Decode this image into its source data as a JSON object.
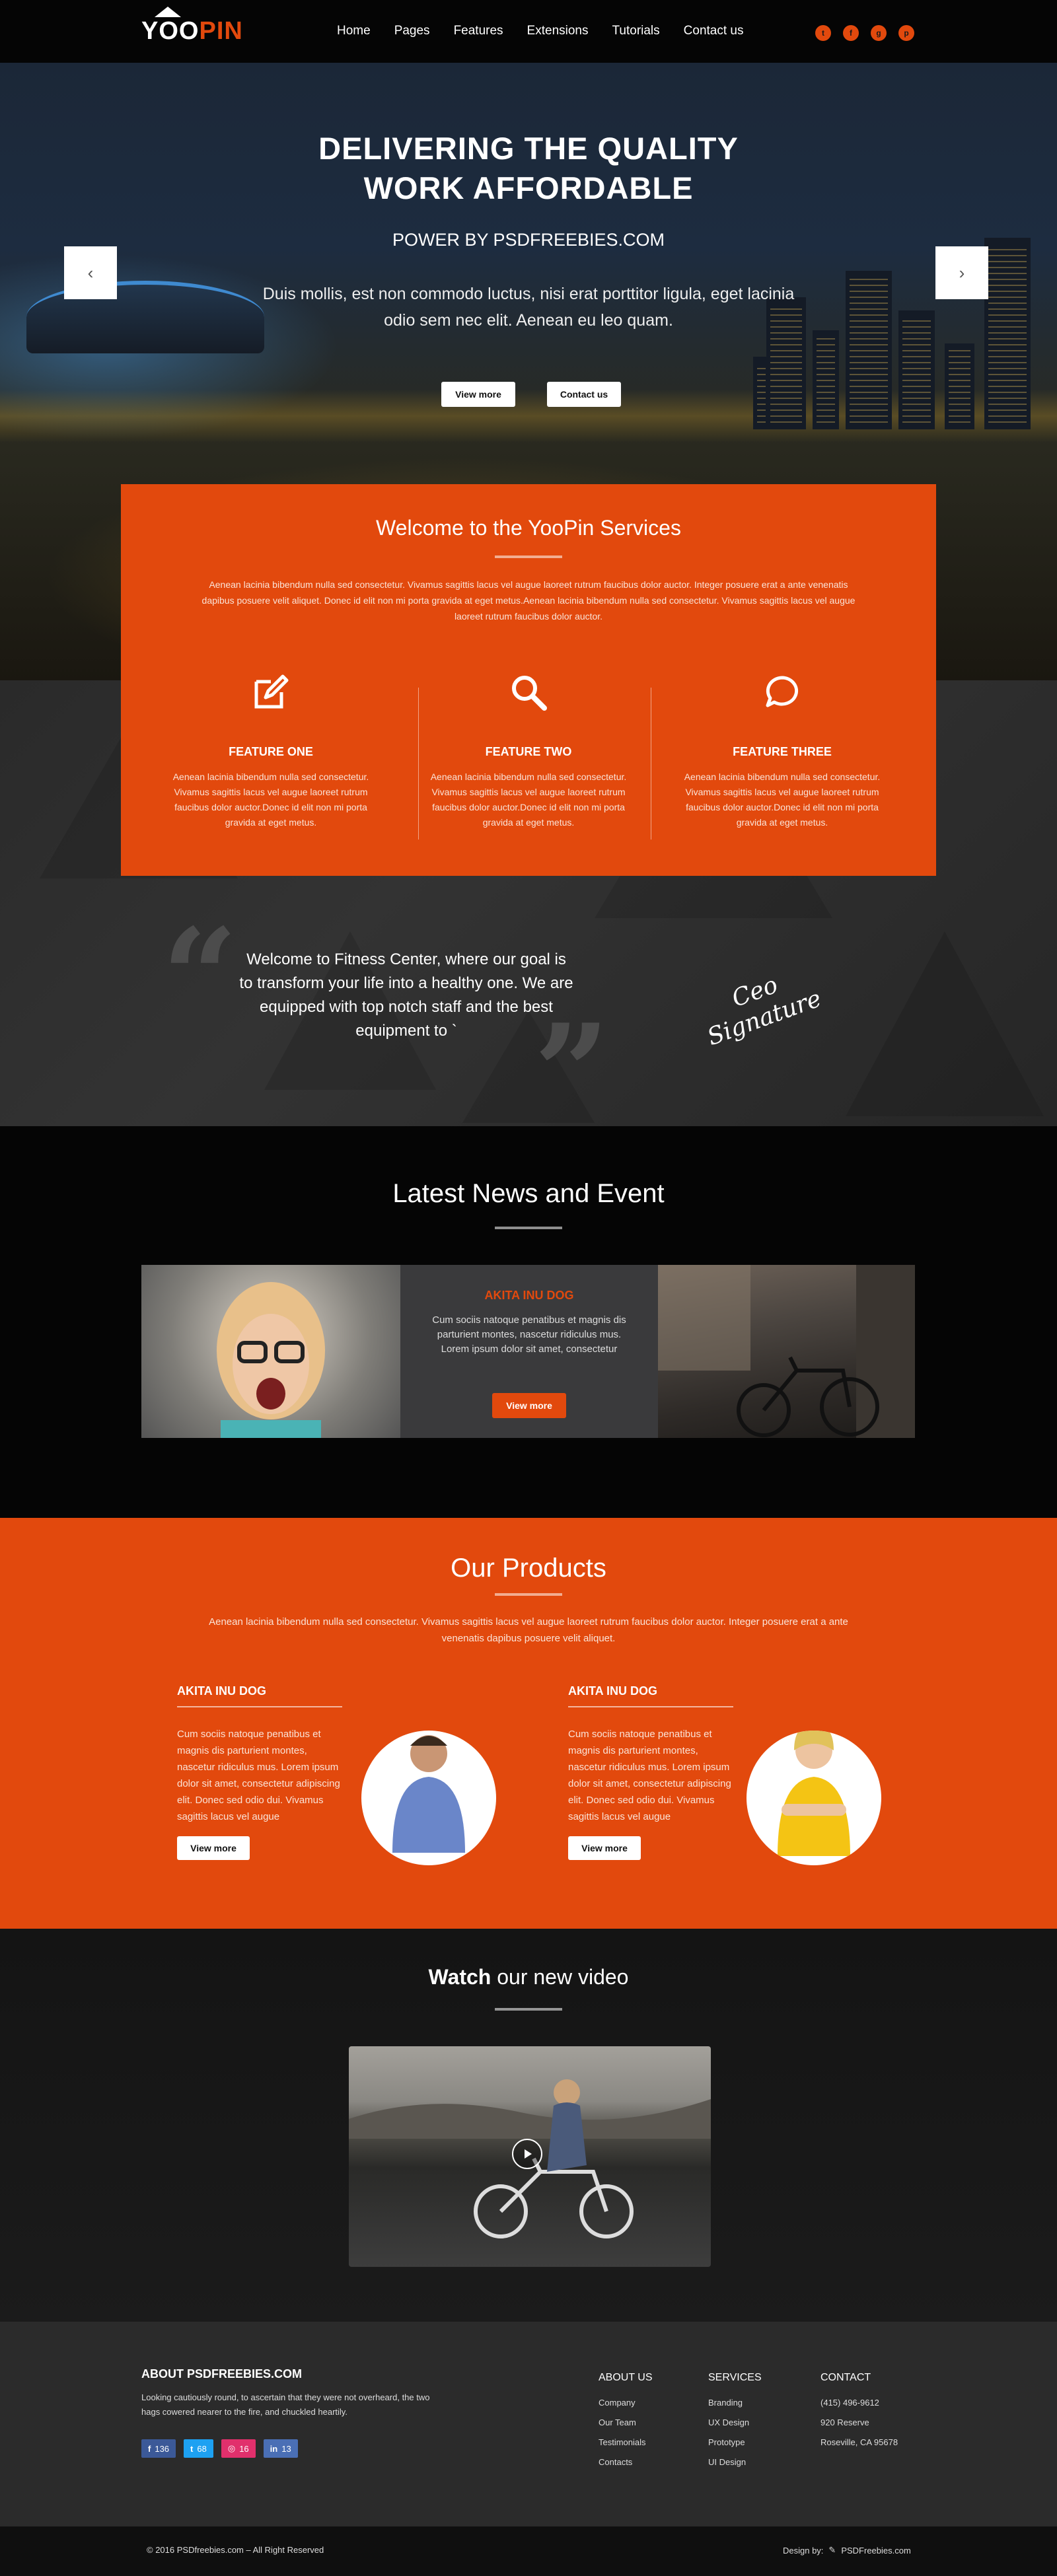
{
  "nav": {
    "logo_a": "YOO",
    "logo_b": "PIN",
    "links": [
      "Home",
      "Pages",
      "Features",
      "Extensions",
      "Tutorials",
      "Contact us"
    ],
    "social": [
      "twitter-icon",
      "facebook-icon",
      "google-plus-icon",
      "pinterest-icon"
    ]
  },
  "hero": {
    "title_line1": "DELIVERING THE QUALITY",
    "title_line2": "WORK AFFORDABLE",
    "subtitle": "POWER BY PSDFREEBIES.COM",
    "paragraph": "Duis mollis, est non commodo luctus, nisi erat porttitor ligula, eget lacinia odio sem nec elit. Aenean eu leo quam.",
    "btn_view_more": "View more",
    "btn_contact": "Contact us",
    "prev_arrow": "‹",
    "next_arrow": "›"
  },
  "welcome": {
    "title_bold": "Welcome",
    "title_rest": " to the YooPin Services",
    "intro": "Aenean lacinia bibendum nulla sed consectetur. Vivamus sagittis lacus vel augue laoreet rutrum faucibus dolor auctor. Integer posuere erat a ante venenatis dapibus posuere velit aliquet. Donec id elit non mi porta gravida at eget metus.Aenean lacinia bibendum nulla sed consectetur. Vivamus sagittis lacus vel augue laoreet rutrum faucibus dolor auctor.",
    "features": [
      {
        "title": "FEATURE ONE",
        "icon": "edit-icon",
        "text": "Aenean lacinia bibendum nulla sed consectetur. Vivamus sagittis lacus vel augue laoreet rutrum faucibus dolor auctor.Donec id elit non mi porta gravida at eget metus."
      },
      {
        "title": "FEATURE TWO",
        "icon": "search-icon",
        "text": "Aenean lacinia bibendum nulla sed consectetur. Vivamus sagittis lacus vel augue laoreet rutrum faucibus dolor auctor.Donec id elit non mi porta gravida at eget metus."
      },
      {
        "title": "FEATURE THREE",
        "icon": "chat-icon",
        "text": "Aenean lacinia bibendum nulla sed consectetur. Vivamus sagittis lacus vel augue laoreet rutrum faucibus dolor auctor.Donec id elit non mi porta gravida at eget metus."
      }
    ]
  },
  "quote": {
    "open_mark": "“",
    "close_mark": "”",
    "text": "Welcome to Fitness Center, where our goal is to transform your life into a healthy one. We are equipped with top notch staff and the best equipment to `",
    "signature_line1": "Ceo",
    "signature_line2": "Signature"
  },
  "news": {
    "heading": "Latest News and Event",
    "card_title": "AKITA INU DOG",
    "card_text": "Cum sociis natoque penatibus et magnis dis parturient montes, nascetur ridiculus mus. Lorem ipsum dolor sit amet, consectetur",
    "card_btn": "View more"
  },
  "products": {
    "heading": "Our Products",
    "intro": "Aenean lacinia bibendum nulla sed consectetur. Vivamus sagittis lacus vel augue laoreet rutrum faucibus dolor auctor. Integer posuere erat a ante venenatis dapibus posuere velit aliquet.",
    "items": [
      {
        "title": "AKITA INU DOG",
        "text": "Cum sociis natoque penatibus et magnis dis parturient montes, nascetur ridiculus mus. Lorem ipsum dolor sit amet, consectetur adipiscing elit. Donec sed odio dui. Vivamus sagittis lacus vel augue",
        "btn": "View more"
      },
      {
        "title": "AKITA INU DOG",
        "text": "Cum sociis natoque penatibus et magnis dis parturient montes, nascetur ridiculus mus. Lorem ipsum dolor sit amet, consectetur adipiscing elit. Donec sed odio dui. Vivamus sagittis lacus vel augue",
        "btn": "View more"
      }
    ]
  },
  "video": {
    "heading_bold": "Watch",
    "heading_rest": " our new video"
  },
  "footer": {
    "about_title": "ABOUT PSDFREEBIES.COM",
    "about_text": "Looking cautiously round, to ascertain that they were not overheard, the two hags cowered nearer to the fire, and chuckled heartily.",
    "badges": [
      {
        "icon": "f",
        "count": "136",
        "color": "#3b5998"
      },
      {
        "icon": "t",
        "count": "68",
        "color": "#1da1f2"
      },
      {
        "icon": "◎",
        "count": "16",
        "color": "#e1306c"
      },
      {
        "icon": "in",
        "count": "13",
        "color": "#4a6fb5"
      }
    ],
    "about_us_title": "ABOUT US",
    "about_us_links": [
      "Company",
      "Our Team",
      "Testimonials",
      "Contacts"
    ],
    "services_title": "SERVICES",
    "services_links": [
      "Branding",
      "UX Design",
      "Prototype",
      "UI Design"
    ],
    "contact_title": "CONTACT",
    "contact_lines": [
      "(415) 496-9612",
      "920 Reserve",
      "Roseville, CA 95678"
    ],
    "copyright": "© 2016 PSDfreebies.com  –  All Right Reserved",
    "design_by": "Design by:",
    "design_brand": "PSDFreebies.com"
  }
}
